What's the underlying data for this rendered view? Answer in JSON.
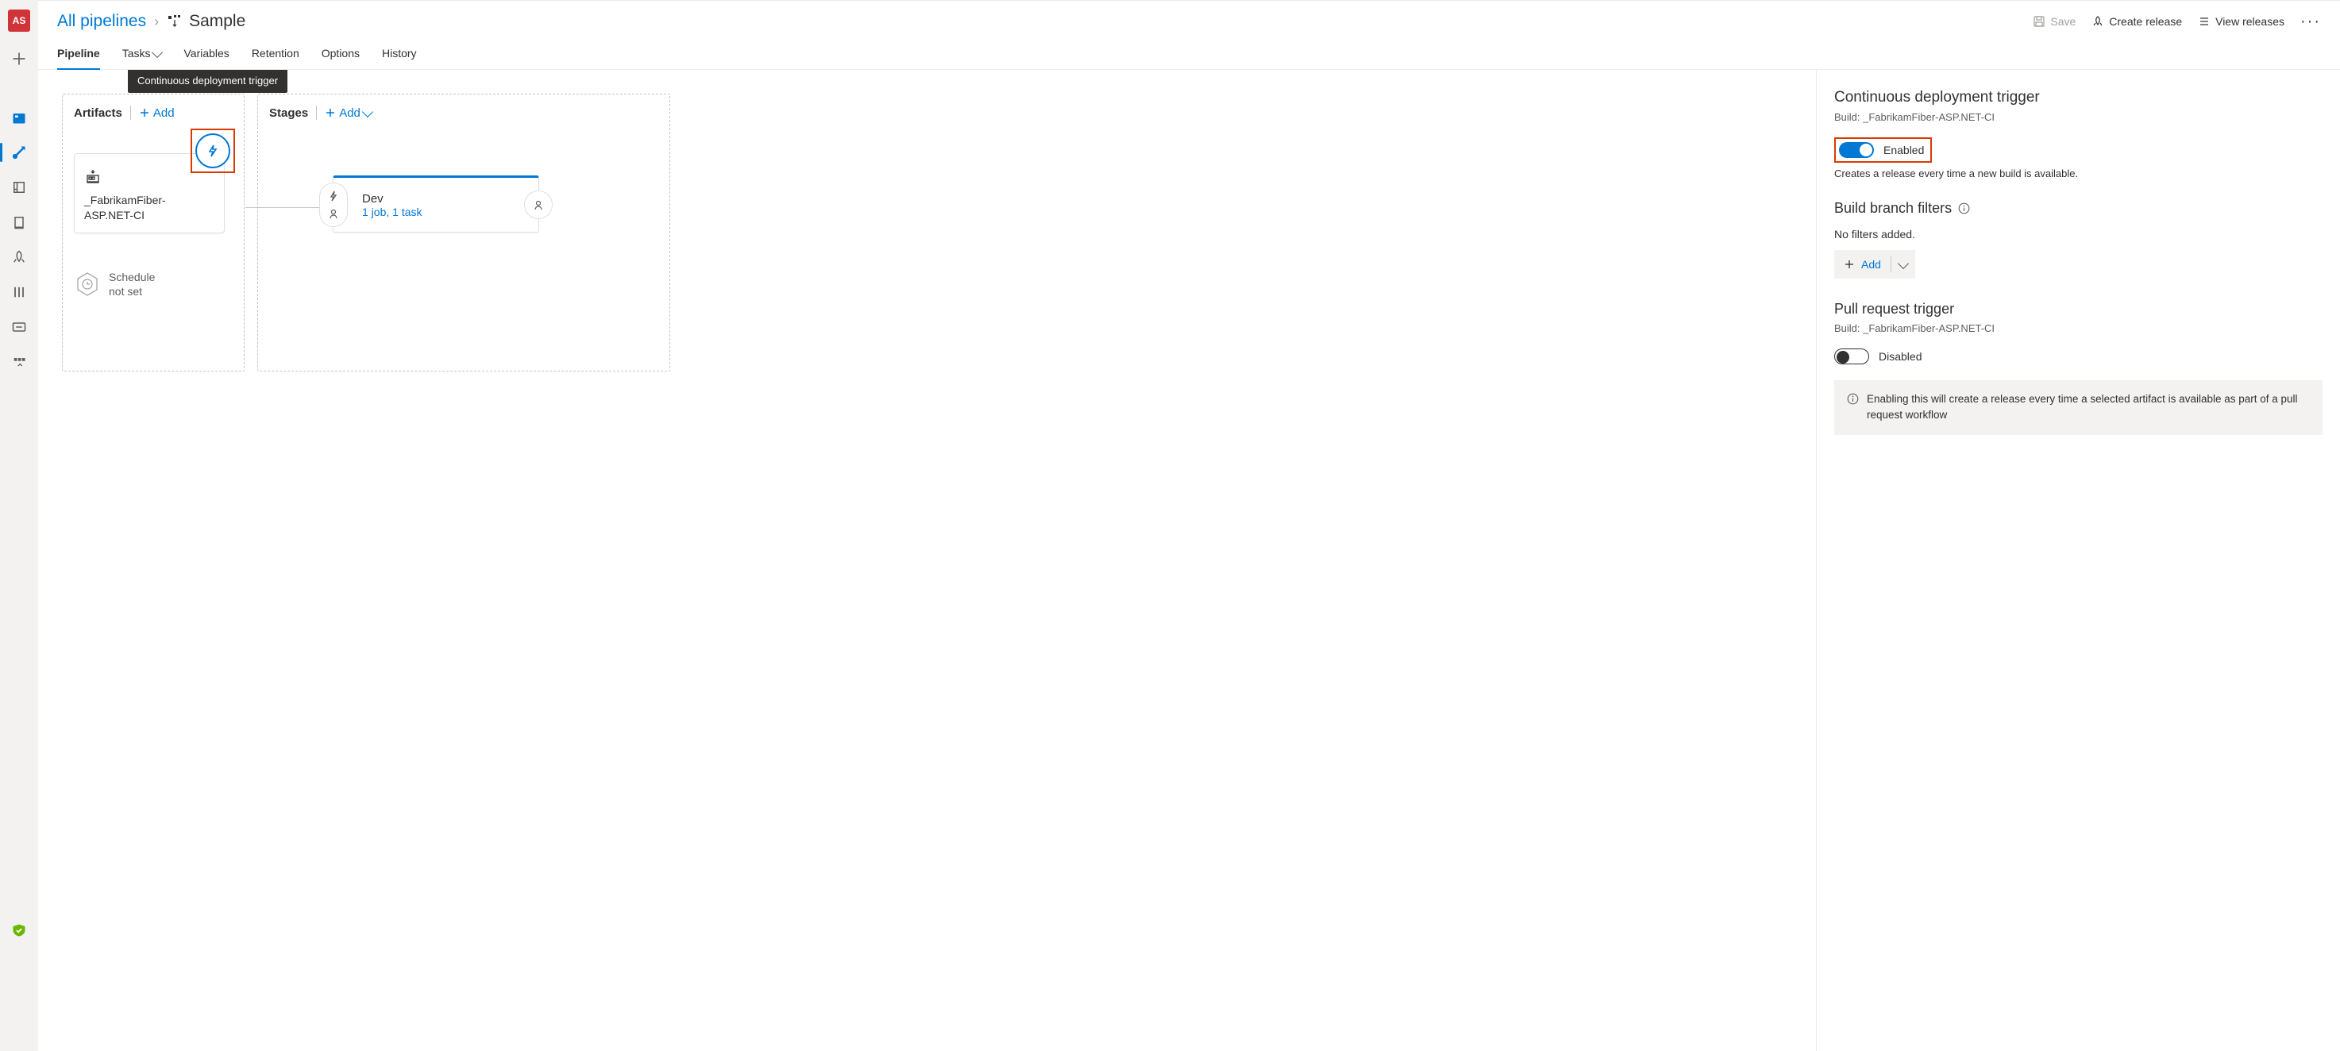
{
  "avatar_initials": "AS",
  "breadcrumb_root": "All pipelines",
  "page_title": "Sample",
  "header_actions": {
    "save": "Save",
    "create_release": "Create release",
    "view_releases": "View releases"
  },
  "tabs": {
    "pipeline": "Pipeline",
    "tasks": "Tasks",
    "variables": "Variables",
    "retention": "Retention",
    "options": "Options",
    "history": "History"
  },
  "artifacts": {
    "heading": "Artifacts",
    "add": "Add",
    "tooltip": "Continuous deployment trigger",
    "card_name": "_FabrikamFiber-ASP.NET-CI",
    "schedule_l1": "Schedule",
    "schedule_l2": "not set"
  },
  "stages": {
    "heading": "Stages",
    "add": "Add",
    "card_name": "Dev",
    "card_detail": "1 job, 1 task"
  },
  "panel": {
    "cd_title": "Continuous deployment trigger",
    "cd_build": "Build: _FabrikamFiber-ASP.NET-CI",
    "cd_enabled_label": "Enabled",
    "cd_desc": "Creates a release every time a new build is available.",
    "bbf_title": "Build branch filters",
    "bbf_empty": "No filters added.",
    "bbf_add": "Add",
    "pr_title": "Pull request trigger",
    "pr_build": "Build: _FabrikamFiber-ASP.NET-CI",
    "pr_disabled_label": "Disabled",
    "pr_info": "Enabling this will create a release every time a selected artifact is available as part of a pull request workflow"
  }
}
